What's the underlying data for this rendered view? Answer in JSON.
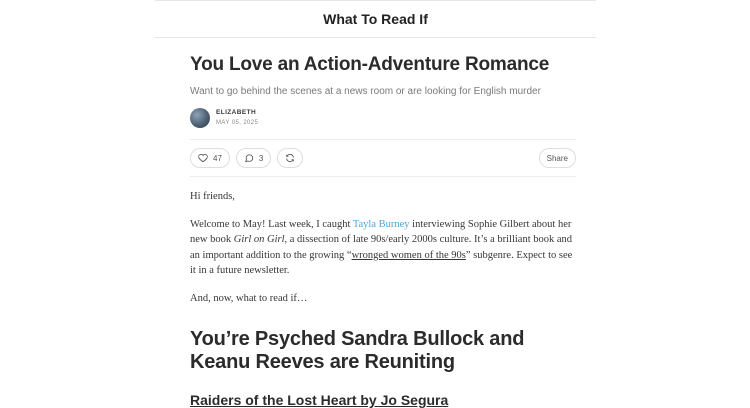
{
  "header": {
    "publication_title": "What To Read If"
  },
  "post": {
    "title": "You Love an Action-Adventure Romance",
    "subtitle": "Want to go behind the scenes at a news room or are looking for English murder",
    "author": "ELIZABETH",
    "date": "MAY 05, 2025"
  },
  "actions": {
    "likes": "47",
    "comments": "3",
    "share_label": "Share"
  },
  "content": {
    "greeting": "Hi friends,",
    "p1_a": "Welcome to May! Last week, I caught ",
    "p1_link": "Tayla Burney",
    "p1_b": " interviewing Sophie Gilbert about her new book ",
    "p1_book": "Girl on Girl",
    "p1_c": ", a dissection of late 90s/early 2000s culture. It’s a brilliant book and an important addition to the growing “",
    "p1_link2": "wronged women of the 90s",
    "p1_d": "” subgenre. Expect to see it in a future newsletter.",
    "p2": "And, now, what to read if…",
    "heading": "You’re Psyched Sandra Bullock and Keanu Reeves are Reuniting",
    "subheading": "Raiders of the Lost Heart by Jo Segura"
  }
}
